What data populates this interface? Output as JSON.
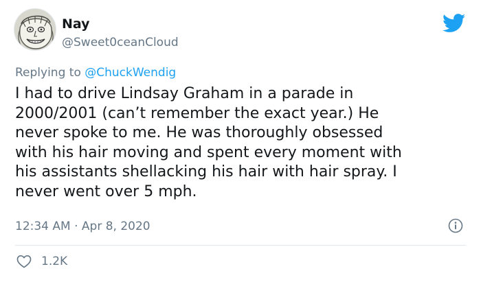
{
  "tweet": {
    "display_name": "Nay",
    "handle": "@Sweet0ceanCloud",
    "reply_prefix": "Replying to",
    "reply_to": "@ChuckWendig",
    "text": "I had to drive Lindsay Graham in a parade in\n2000/2001 (can’t remember the exact year.) He\nnever spoke to me. He was thoroughly obsessed\nwith his hair moving and spent every moment with\nhis assistants shellacking his hair with hair spray. I\nnever went over 5 mph.",
    "timestamp": "12:34 AM · Apr 8, 2020",
    "likes": "1.2K"
  },
  "icons": {
    "logo": "twitter-bird-icon",
    "info": "info-icon",
    "like": "heart-icon"
  },
  "colors": {
    "brand": "#1da1f2",
    "muted": "#657786",
    "text": "#14171a",
    "divider": "#e1e8ed"
  }
}
